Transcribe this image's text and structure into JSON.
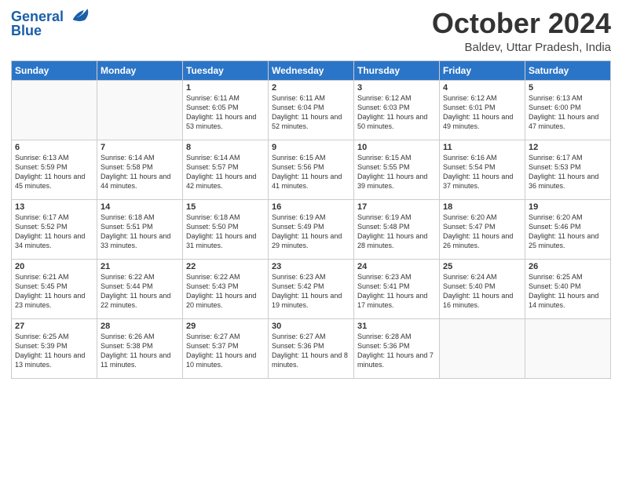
{
  "header": {
    "logo_line1": "General",
    "logo_line2": "Blue",
    "month": "October 2024",
    "location": "Baldev, Uttar Pradesh, India"
  },
  "weekdays": [
    "Sunday",
    "Monday",
    "Tuesday",
    "Wednesday",
    "Thursday",
    "Friday",
    "Saturday"
  ],
  "weeks": [
    [
      {
        "day": "",
        "sunrise": "",
        "sunset": "",
        "daylight": ""
      },
      {
        "day": "",
        "sunrise": "",
        "sunset": "",
        "daylight": ""
      },
      {
        "day": "1",
        "sunrise": "Sunrise: 6:11 AM",
        "sunset": "Sunset: 6:05 PM",
        "daylight": "Daylight: 11 hours and 53 minutes."
      },
      {
        "day": "2",
        "sunrise": "Sunrise: 6:11 AM",
        "sunset": "Sunset: 6:04 PM",
        "daylight": "Daylight: 11 hours and 52 minutes."
      },
      {
        "day": "3",
        "sunrise": "Sunrise: 6:12 AM",
        "sunset": "Sunset: 6:03 PM",
        "daylight": "Daylight: 11 hours and 50 minutes."
      },
      {
        "day": "4",
        "sunrise": "Sunrise: 6:12 AM",
        "sunset": "Sunset: 6:01 PM",
        "daylight": "Daylight: 11 hours and 49 minutes."
      },
      {
        "day": "5",
        "sunrise": "Sunrise: 6:13 AM",
        "sunset": "Sunset: 6:00 PM",
        "daylight": "Daylight: 11 hours and 47 minutes."
      }
    ],
    [
      {
        "day": "6",
        "sunrise": "Sunrise: 6:13 AM",
        "sunset": "Sunset: 5:59 PM",
        "daylight": "Daylight: 11 hours and 45 minutes."
      },
      {
        "day": "7",
        "sunrise": "Sunrise: 6:14 AM",
        "sunset": "Sunset: 5:58 PM",
        "daylight": "Daylight: 11 hours and 44 minutes."
      },
      {
        "day": "8",
        "sunrise": "Sunrise: 6:14 AM",
        "sunset": "Sunset: 5:57 PM",
        "daylight": "Daylight: 11 hours and 42 minutes."
      },
      {
        "day": "9",
        "sunrise": "Sunrise: 6:15 AM",
        "sunset": "Sunset: 5:56 PM",
        "daylight": "Daylight: 11 hours and 41 minutes."
      },
      {
        "day": "10",
        "sunrise": "Sunrise: 6:15 AM",
        "sunset": "Sunset: 5:55 PM",
        "daylight": "Daylight: 11 hours and 39 minutes."
      },
      {
        "day": "11",
        "sunrise": "Sunrise: 6:16 AM",
        "sunset": "Sunset: 5:54 PM",
        "daylight": "Daylight: 11 hours and 37 minutes."
      },
      {
        "day": "12",
        "sunrise": "Sunrise: 6:17 AM",
        "sunset": "Sunset: 5:53 PM",
        "daylight": "Daylight: 11 hours and 36 minutes."
      }
    ],
    [
      {
        "day": "13",
        "sunrise": "Sunrise: 6:17 AM",
        "sunset": "Sunset: 5:52 PM",
        "daylight": "Daylight: 11 hours and 34 minutes."
      },
      {
        "day": "14",
        "sunrise": "Sunrise: 6:18 AM",
        "sunset": "Sunset: 5:51 PM",
        "daylight": "Daylight: 11 hours and 33 minutes."
      },
      {
        "day": "15",
        "sunrise": "Sunrise: 6:18 AM",
        "sunset": "Sunset: 5:50 PM",
        "daylight": "Daylight: 11 hours and 31 minutes."
      },
      {
        "day": "16",
        "sunrise": "Sunrise: 6:19 AM",
        "sunset": "Sunset: 5:49 PM",
        "daylight": "Daylight: 11 hours and 29 minutes."
      },
      {
        "day": "17",
        "sunrise": "Sunrise: 6:19 AM",
        "sunset": "Sunset: 5:48 PM",
        "daylight": "Daylight: 11 hours and 28 minutes."
      },
      {
        "day": "18",
        "sunrise": "Sunrise: 6:20 AM",
        "sunset": "Sunset: 5:47 PM",
        "daylight": "Daylight: 11 hours and 26 minutes."
      },
      {
        "day": "19",
        "sunrise": "Sunrise: 6:20 AM",
        "sunset": "Sunset: 5:46 PM",
        "daylight": "Daylight: 11 hours and 25 minutes."
      }
    ],
    [
      {
        "day": "20",
        "sunrise": "Sunrise: 6:21 AM",
        "sunset": "Sunset: 5:45 PM",
        "daylight": "Daylight: 11 hours and 23 minutes."
      },
      {
        "day": "21",
        "sunrise": "Sunrise: 6:22 AM",
        "sunset": "Sunset: 5:44 PM",
        "daylight": "Daylight: 11 hours and 22 minutes."
      },
      {
        "day": "22",
        "sunrise": "Sunrise: 6:22 AM",
        "sunset": "Sunset: 5:43 PM",
        "daylight": "Daylight: 11 hours and 20 minutes."
      },
      {
        "day": "23",
        "sunrise": "Sunrise: 6:23 AM",
        "sunset": "Sunset: 5:42 PM",
        "daylight": "Daylight: 11 hours and 19 minutes."
      },
      {
        "day": "24",
        "sunrise": "Sunrise: 6:23 AM",
        "sunset": "Sunset: 5:41 PM",
        "daylight": "Daylight: 11 hours and 17 minutes."
      },
      {
        "day": "25",
        "sunrise": "Sunrise: 6:24 AM",
        "sunset": "Sunset: 5:40 PM",
        "daylight": "Daylight: 11 hours and 16 minutes."
      },
      {
        "day": "26",
        "sunrise": "Sunrise: 6:25 AM",
        "sunset": "Sunset: 5:40 PM",
        "daylight": "Daylight: 11 hours and 14 minutes."
      }
    ],
    [
      {
        "day": "27",
        "sunrise": "Sunrise: 6:25 AM",
        "sunset": "Sunset: 5:39 PM",
        "daylight": "Daylight: 11 hours and 13 minutes."
      },
      {
        "day": "28",
        "sunrise": "Sunrise: 6:26 AM",
        "sunset": "Sunset: 5:38 PM",
        "daylight": "Daylight: 11 hours and 11 minutes."
      },
      {
        "day": "29",
        "sunrise": "Sunrise: 6:27 AM",
        "sunset": "Sunset: 5:37 PM",
        "daylight": "Daylight: 11 hours and 10 minutes."
      },
      {
        "day": "30",
        "sunrise": "Sunrise: 6:27 AM",
        "sunset": "Sunset: 5:36 PM",
        "daylight": "Daylight: 11 hours and 8 minutes."
      },
      {
        "day": "31",
        "sunrise": "Sunrise: 6:28 AM",
        "sunset": "Sunset: 5:36 PM",
        "daylight": "Daylight: 11 hours and 7 minutes."
      },
      {
        "day": "",
        "sunrise": "",
        "sunset": "",
        "daylight": ""
      },
      {
        "day": "",
        "sunrise": "",
        "sunset": "",
        "daylight": ""
      }
    ]
  ]
}
